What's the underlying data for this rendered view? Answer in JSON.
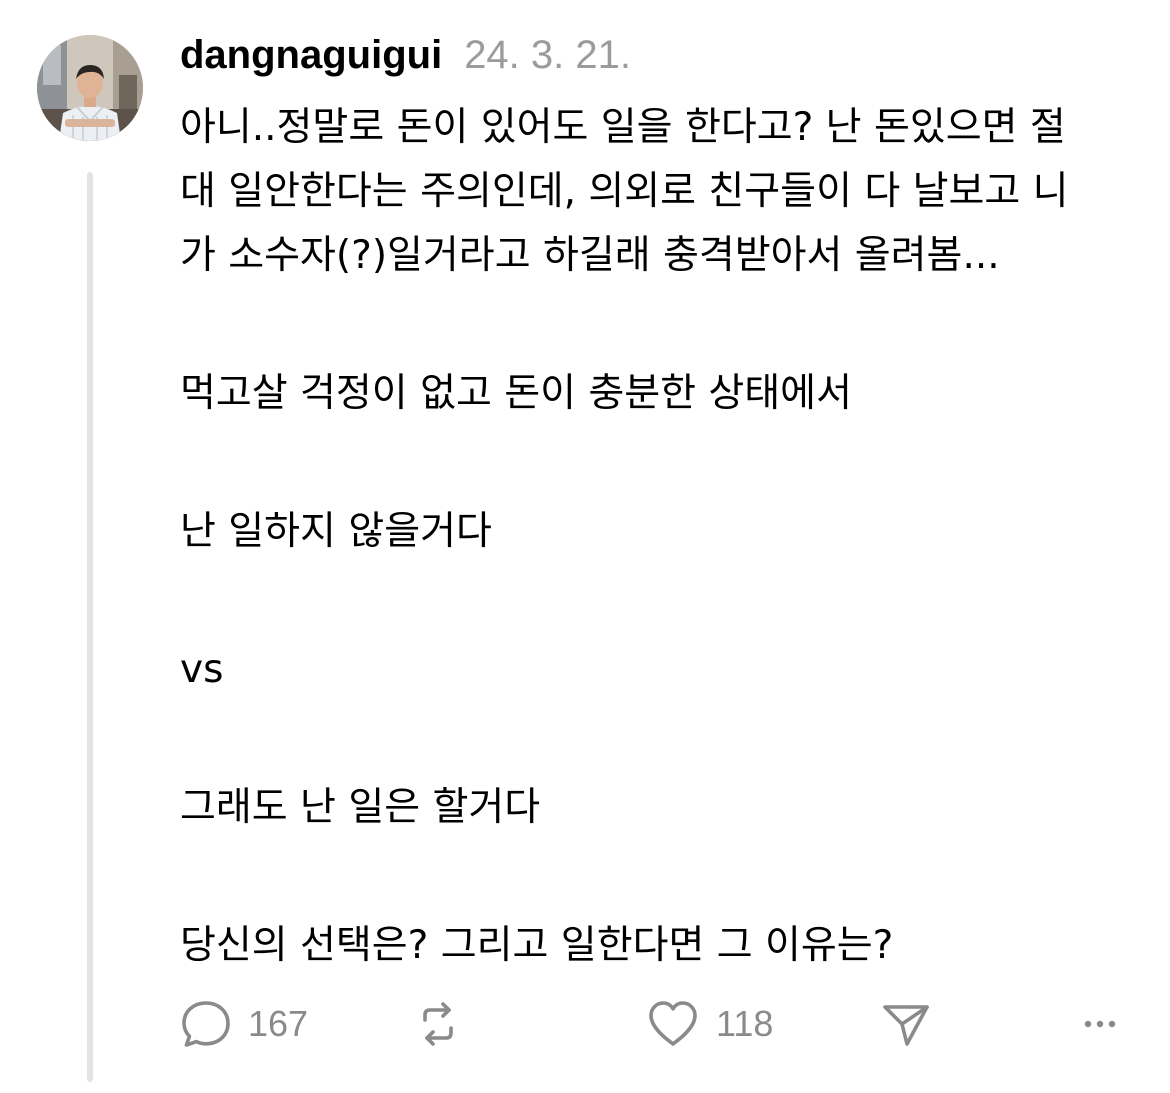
{
  "post": {
    "author": "dangnaguigui",
    "date": "24. 3. 21.",
    "lines": {
      "l1": "아니..정말로 돈이 있어도 일을 한다고? 난 돈있으면 절",
      "l2": "대 일안한다는 주의인데, 의외로 친구들이 다 날보고 니",
      "l3": "가 소수자(?)일거라고 하길래 충격받아서 올려봄...",
      "l4": "먹고살 걱정이 없고 돈이 충분한 상태에서",
      "l5": "난 일하지 않을거다",
      "l6": "vs",
      "l7": "그래도 난 일은 할거다",
      "l8": "당신의 선택은? 그리고 일한다면 그 이유는?"
    }
  },
  "actions": {
    "reply_count": "167",
    "like_count": "118",
    "icons": {
      "reply": "speech-bubble-icon",
      "repost": "repost-arrows-icon",
      "like": "heart-icon",
      "share": "paper-plane-icon",
      "more": "ellipsis-icon"
    }
  },
  "colors": {
    "text": "#000000",
    "muted": "#9b9b9b",
    "icon": "#8a8a8a",
    "thread_line": "#e3e3e3"
  }
}
